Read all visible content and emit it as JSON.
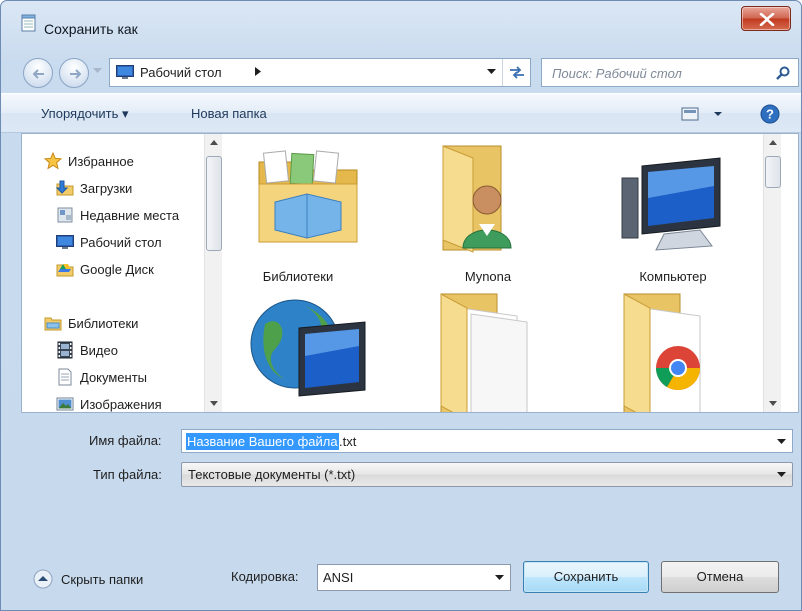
{
  "window": {
    "title": "Сохранить как",
    "close_glyph": "x"
  },
  "address": {
    "location": "Рабочий стол",
    "search_placeholder": "Поиск: Рабочий стол"
  },
  "toolbar": {
    "organize_label": "Упорядочить ▾",
    "new_folder_label": "Новая папка"
  },
  "nav": {
    "favorites": {
      "label": "Избранное",
      "items": [
        {
          "label": "Загрузки",
          "icon": "downloads-icon"
        },
        {
          "label": "Недавние места",
          "icon": "recent-places-icon"
        },
        {
          "label": "Рабочий стол",
          "icon": "desktop-icon"
        },
        {
          "label": "Google Диск",
          "icon": "google-drive-icon"
        }
      ]
    },
    "libraries": {
      "label": "Библиотеки",
      "items": [
        {
          "label": "Видео",
          "icon": "video-icon"
        },
        {
          "label": "Документы",
          "icon": "documents-icon"
        },
        {
          "label": "Изображения",
          "icon": "pictures-icon"
        }
      ]
    }
  },
  "files": [
    {
      "label": "Библиотеки",
      "icon": "libraries-folder-icon"
    },
    {
      "label": "Mynona",
      "icon": "user-folder-icon"
    },
    {
      "label": "Компьютер",
      "icon": "computer-icon"
    },
    {
      "label": "",
      "icon": "network-icon"
    },
    {
      "label": "",
      "icon": "folder-icon"
    },
    {
      "label": "",
      "icon": "chrome-folder-icon"
    }
  ],
  "form": {
    "filename_label": "Имя файла:",
    "filename_selected": "Название Вашего файла",
    "filename_rest": ".txt",
    "filetype_label": "Тип файла:",
    "filetype_value": "Текстовые документы (*.txt)"
  },
  "footer": {
    "hide_folders_label": "Скрыть папки",
    "encoding_label": "Кодировка:",
    "encoding_value": "ANSI",
    "save_label": "Сохранить",
    "cancel_label": "Отмена"
  },
  "colors": {
    "selection": "#3399ff",
    "window_bg": "#c9dbee",
    "close_red": "#c0391f"
  }
}
